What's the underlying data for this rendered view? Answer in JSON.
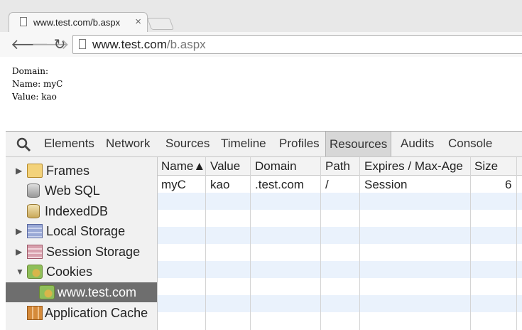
{
  "browser": {
    "tab_title": "www.test.com/b.aspx",
    "tab_close": "×",
    "url_host": "www.test.com",
    "url_path": "/b.aspx"
  },
  "page": {
    "lines": [
      "Domain:",
      "Name: myC",
      "Value: kao"
    ]
  },
  "devtools": {
    "tabs": [
      "Elements",
      "Network",
      "Sources",
      "Timeline",
      "Profiles",
      "Resources",
      "Audits",
      "Console"
    ],
    "active_tab": "Resources",
    "sidebar": [
      {
        "label": "Frames",
        "icon": "folder-icon",
        "arrow": "▶"
      },
      {
        "label": "Web SQL",
        "icon": "database-icon",
        "arrow": ""
      },
      {
        "label": "IndexedDB",
        "icon": "indexeddb-icon",
        "arrow": ""
      },
      {
        "label": "Local Storage",
        "icon": "local-storage-icon",
        "arrow": "▶"
      },
      {
        "label": "Session Storage",
        "icon": "session-storage-icon",
        "arrow": "▶"
      },
      {
        "label": "Cookies",
        "icon": "cookie-icon",
        "arrow": "▼"
      },
      {
        "label": "www.test.com",
        "icon": "cookie-icon",
        "arrow": ""
      },
      {
        "label": "Application Cache",
        "icon": "app-cache-icon",
        "arrow": ""
      }
    ],
    "selected_sidebar": "www.test.com",
    "table": {
      "headers": [
        "Name▲",
        "Value",
        "Domain",
        "Path",
        "Expires / Max-Age",
        "Size"
      ],
      "rows": [
        [
          "myC",
          "kao",
          ".test.com",
          "/",
          "Session",
          "6"
        ]
      ]
    }
  }
}
